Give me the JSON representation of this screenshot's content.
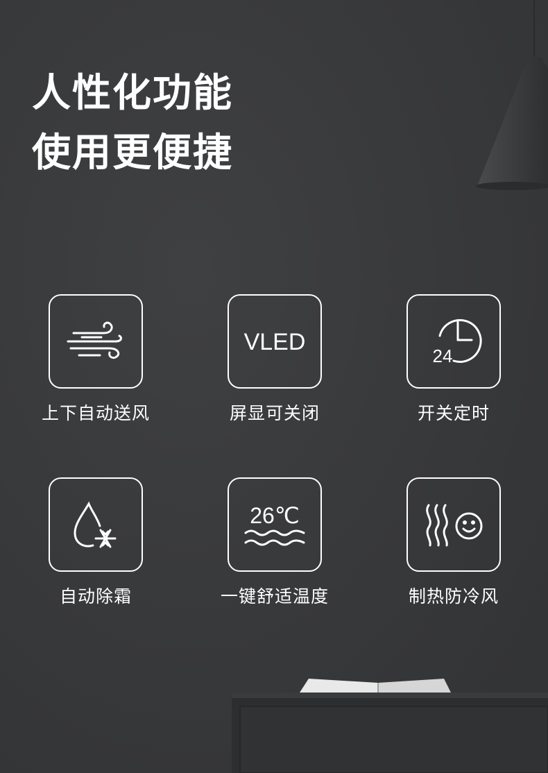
{
  "headline": {
    "line1": "人性化功能",
    "line2": "使用更便捷"
  },
  "features": [
    {
      "label": "上下自动送风",
      "icon": "wind-icon"
    },
    {
      "label": "屏显可关闭",
      "icon": "vled-display-icon",
      "icon_text": "VLED"
    },
    {
      "label": "开关定时",
      "icon": "timer-24h-icon",
      "icon_text": "24"
    },
    {
      "label": "自动除霜",
      "icon": "drop-snowflake-icon"
    },
    {
      "label": "一键舒适温度",
      "icon": "comfort-temperature-icon",
      "icon_text": "26℃"
    },
    {
      "label": "制热防冷风",
      "icon": "heat-smile-icon"
    }
  ],
  "colors": {
    "background": "#38393b",
    "foreground": "#ffffff"
  }
}
